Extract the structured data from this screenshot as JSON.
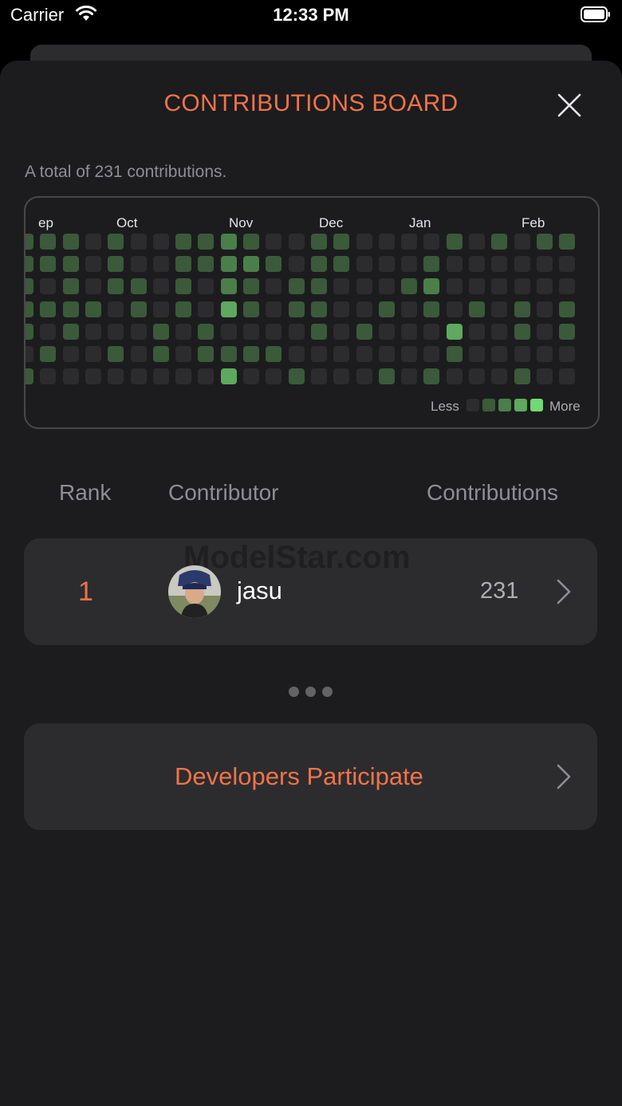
{
  "status_bar": {
    "carrier": "Carrier",
    "time": "12:33 PM"
  },
  "board": {
    "title": "CONTRIBUTIONS BOARD",
    "total_text": "A total of 231 contributions.",
    "months": [
      "ep",
      "Oct",
      "Nov",
      "Dec",
      "Jan",
      "Feb"
    ],
    "legend": {
      "less": "Less",
      "more": "More"
    },
    "level_colors": [
      "#2c2c2e",
      "#3a5a3a",
      "#4a7f4a",
      "#5fa85f",
      "#74d874"
    ],
    "grid": [
      "1110100112100110000101011",
      "1110100112210110001000000",
      "1010110102101100012000000",
      "1111010103101100101010101",
      "1010001010000101000300101",
      "0100101011110000000100000",
      "1000000003001000101000100"
    ]
  },
  "table": {
    "headers": {
      "rank": "Rank",
      "contributor": "Contributor",
      "contributions": "Contributions"
    },
    "rows": [
      {
        "rank": "1",
        "name": "jasu",
        "count": "231"
      }
    ],
    "watermark": "ModelStar.com"
  },
  "participate": {
    "label": "Developers Participate"
  },
  "icons": {
    "close": "close-icon",
    "chevron": "chevron-right-icon",
    "wifi": "wifi-icon",
    "battery": "battery-icon"
  }
}
